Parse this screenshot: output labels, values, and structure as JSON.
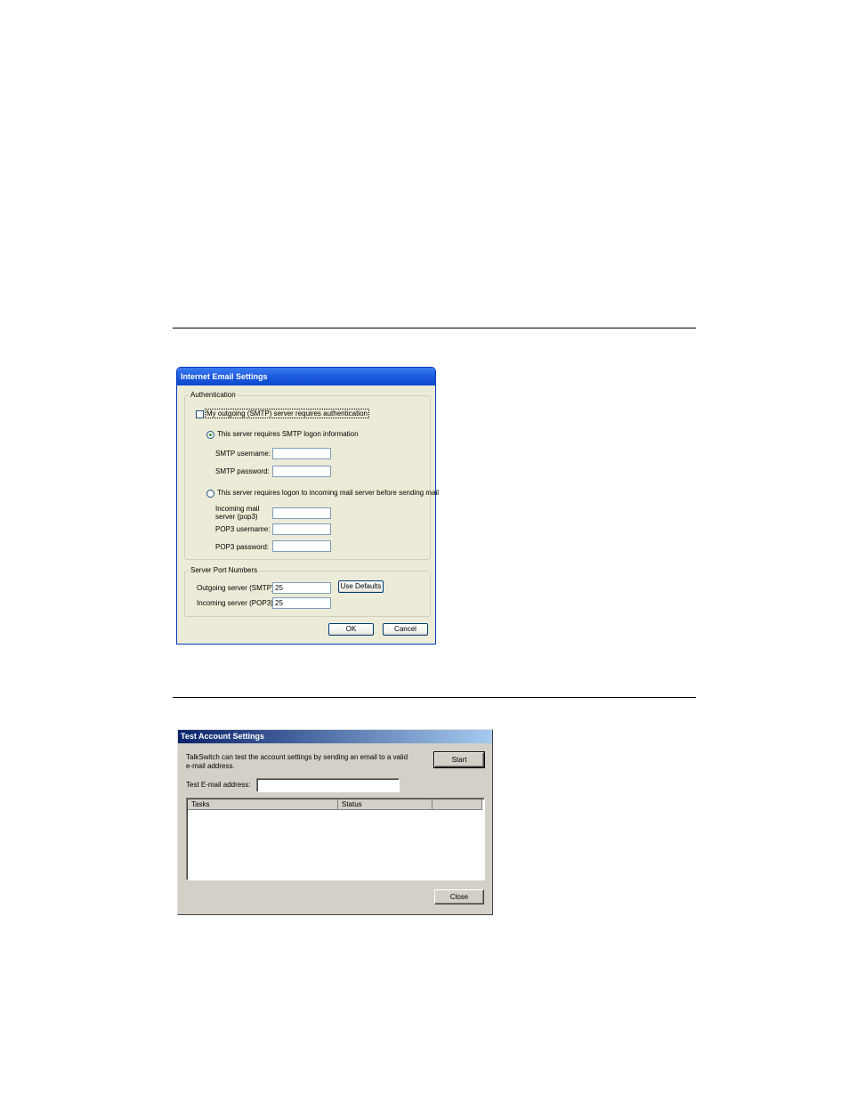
{
  "email_dialog": {
    "title": "Internet Email Settings",
    "authentication": {
      "legend": "Authentication",
      "requires_auth_label": "My outgoing (SMTP) server requires authentication",
      "smtp_logon_option": "This server requires SMTP logon information",
      "smtp_username_label": "SMTP username:",
      "smtp_username_value": "",
      "smtp_password_label": "SMTP password:",
      "smtp_password_value": "",
      "pop_logon_option": "This server requires logon to incoming mail server before sending mail",
      "incoming_server_label_1": "Incoming mail",
      "incoming_server_label_2": "server (pop3)",
      "incoming_server_value": "",
      "pop3_username_label": "POP3 username:",
      "pop3_username_value": "",
      "pop3_password_label": "POP3 password:",
      "pop3_password_value": ""
    },
    "ports": {
      "legend": "Server Port Numbers",
      "outgoing_label": "Outgoing server (SMTP):",
      "outgoing_value": "25",
      "incoming_label": "Incoming server (POP3):",
      "incoming_value": "25",
      "use_defaults_label": "Use Defaults"
    },
    "ok_label": "OK",
    "cancel_label": "Cancel"
  },
  "test_dialog": {
    "title": "Test Account Settings",
    "description_line1": "TalkSwitch can test the account settings by sending an email to a valid",
    "description_line2": "e-mail address.",
    "start_label": "Start",
    "test_email_label": "Test E-mail address:",
    "test_email_value": "",
    "columns": [
      "Tasks",
      "Status",
      ""
    ],
    "close_label": "Close"
  }
}
